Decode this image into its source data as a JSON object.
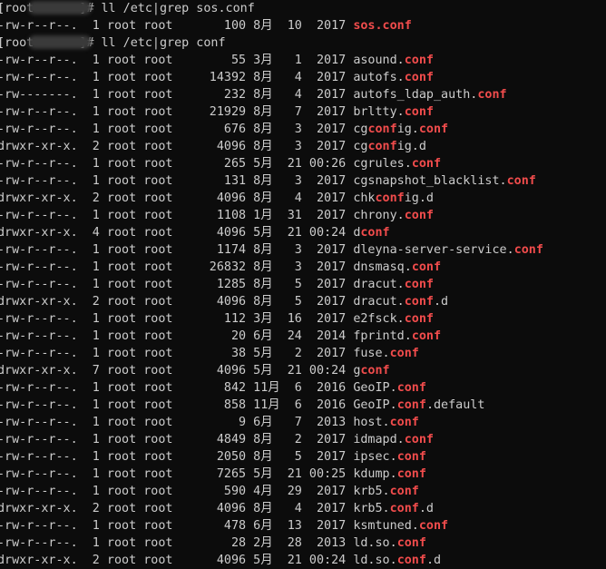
{
  "terminal": {
    "prompt_user": "[root",
    "prompt_suffix": "]#",
    "commands": [
      {
        "command": "ll /etc|grep sos.conf",
        "pattern": "conf",
        "rows": [
          {
            "perm": "-rw-r--r--.",
            "links": "1",
            "owner": "root",
            "group": "root",
            "size": "100",
            "month": "8月",
            "day": "10",
            "time": "2017",
            "name": "sos.conf",
            "whole_highlight": true
          }
        ]
      },
      {
        "command": "ll /etc|grep conf",
        "pattern": "conf",
        "rows": [
          {
            "perm": "-rw-r--r--.",
            "links": "1",
            "owner": "root",
            "group": "root",
            "size": "55",
            "month": "3月",
            "day": "1",
            "time": "2017",
            "name": "asound.conf"
          },
          {
            "perm": "-rw-r--r--.",
            "links": "1",
            "owner": "root",
            "group": "root",
            "size": "14392",
            "month": "8月",
            "day": "4",
            "time": "2017",
            "name": "autofs.conf"
          },
          {
            "perm": "-rw-------.",
            "links": "1",
            "owner": "root",
            "group": "root",
            "size": "232",
            "month": "8月",
            "day": "4",
            "time": "2017",
            "name": "autofs_ldap_auth.conf"
          },
          {
            "perm": "-rw-r--r--.",
            "links": "1",
            "owner": "root",
            "group": "root",
            "size": "21929",
            "month": "8月",
            "day": "7",
            "time": "2017",
            "name": "brltty.conf"
          },
          {
            "perm": "-rw-r--r--.",
            "links": "1",
            "owner": "root",
            "group": "root",
            "size": "676",
            "month": "8月",
            "day": "3",
            "time": "2017",
            "name": "cgconfig.conf"
          },
          {
            "perm": "drwxr-xr-x.",
            "links": "2",
            "owner": "root",
            "group": "root",
            "size": "4096",
            "month": "8月",
            "day": "3",
            "time": "2017",
            "name": "cgconfig.d"
          },
          {
            "perm": "-rw-r--r--.",
            "links": "1",
            "owner": "root",
            "group": "root",
            "size": "265",
            "month": "5月",
            "day": "21",
            "time": "00:26",
            "name": "cgrules.conf"
          },
          {
            "perm": "-rw-r--r--.",
            "links": "1",
            "owner": "root",
            "group": "root",
            "size": "131",
            "month": "8月",
            "day": "3",
            "time": "2017",
            "name": "cgsnapshot_blacklist.conf"
          },
          {
            "perm": "drwxr-xr-x.",
            "links": "2",
            "owner": "root",
            "group": "root",
            "size": "4096",
            "month": "8月",
            "day": "4",
            "time": "2017",
            "name": "chkconfig.d"
          },
          {
            "perm": "-rw-r--r--.",
            "links": "1",
            "owner": "root",
            "group": "root",
            "size": "1108",
            "month": "1月",
            "day": "31",
            "time": "2017",
            "name": "chrony.conf"
          },
          {
            "perm": "drwxr-xr-x.",
            "links": "4",
            "owner": "root",
            "group": "root",
            "size": "4096",
            "month": "5月",
            "day": "21",
            "time": "00:24",
            "name": "dconf"
          },
          {
            "perm": "-rw-r--r--.",
            "links": "1",
            "owner": "root",
            "group": "root",
            "size": "1174",
            "month": "8月",
            "day": "3",
            "time": "2017",
            "name": "dleyna-server-service.conf"
          },
          {
            "perm": "-rw-r--r--.",
            "links": "1",
            "owner": "root",
            "group": "root",
            "size": "26832",
            "month": "8月",
            "day": "3",
            "time": "2017",
            "name": "dnsmasq.conf"
          },
          {
            "perm": "-rw-r--r--.",
            "links": "1",
            "owner": "root",
            "group": "root",
            "size": "1285",
            "month": "8月",
            "day": "5",
            "time": "2017",
            "name": "dracut.conf"
          },
          {
            "perm": "drwxr-xr-x.",
            "links": "2",
            "owner": "root",
            "group": "root",
            "size": "4096",
            "month": "8月",
            "day": "5",
            "time": "2017",
            "name": "dracut.conf.d"
          },
          {
            "perm": "-rw-r--r--.",
            "links": "1",
            "owner": "root",
            "group": "root",
            "size": "112",
            "month": "3月",
            "day": "16",
            "time": "2017",
            "name": "e2fsck.conf"
          },
          {
            "perm": "-rw-r--r--.",
            "links": "1",
            "owner": "root",
            "group": "root",
            "size": "20",
            "month": "6月",
            "day": "24",
            "time": "2014",
            "name": "fprintd.conf"
          },
          {
            "perm": "-rw-r--r--.",
            "links": "1",
            "owner": "root",
            "group": "root",
            "size": "38",
            "month": "5月",
            "day": "2",
            "time": "2017",
            "name": "fuse.conf"
          },
          {
            "perm": "drwxr-xr-x.",
            "links": "7",
            "owner": "root",
            "group": "root",
            "size": "4096",
            "month": "5月",
            "day": "21",
            "time": "00:24",
            "name": "gconf"
          },
          {
            "perm": "-rw-r--r--.",
            "links": "1",
            "owner": "root",
            "group": "root",
            "size": "842",
            "month": "11月",
            "day": "6",
            "time": "2016",
            "name": "GeoIP.conf"
          },
          {
            "perm": "-rw-r--r--.",
            "links": "1",
            "owner": "root",
            "group": "root",
            "size": "858",
            "month": "11月",
            "day": "6",
            "time": "2016",
            "name": "GeoIP.conf.default"
          },
          {
            "perm": "-rw-r--r--.",
            "links": "1",
            "owner": "root",
            "group": "root",
            "size": "9",
            "month": "6月",
            "day": "7",
            "time": "2013",
            "name": "host.conf"
          },
          {
            "perm": "-rw-r--r--.",
            "links": "1",
            "owner": "root",
            "group": "root",
            "size": "4849",
            "month": "8月",
            "day": "2",
            "time": "2017",
            "name": "idmapd.conf"
          },
          {
            "perm": "-rw-r--r--.",
            "links": "1",
            "owner": "root",
            "group": "root",
            "size": "2050",
            "month": "8月",
            "day": "5",
            "time": "2017",
            "name": "ipsec.conf"
          },
          {
            "perm": "-rw-r--r--.",
            "links": "1",
            "owner": "root",
            "group": "root",
            "size": "7265",
            "month": "5月",
            "day": "21",
            "time": "00:25",
            "name": "kdump.conf"
          },
          {
            "perm": "-rw-r--r--.",
            "links": "1",
            "owner": "root",
            "group": "root",
            "size": "590",
            "month": "4月",
            "day": "29",
            "time": "2017",
            "name": "krb5.conf"
          },
          {
            "perm": "drwxr-xr-x.",
            "links": "2",
            "owner": "root",
            "group": "root",
            "size": "4096",
            "month": "8月",
            "day": "4",
            "time": "2017",
            "name": "krb5.conf.d"
          },
          {
            "perm": "-rw-r--r--.",
            "links": "1",
            "owner": "root",
            "group": "root",
            "size": "478",
            "month": "6月",
            "day": "13",
            "time": "2017",
            "name": "ksmtuned.conf"
          },
          {
            "perm": "-rw-r--r--.",
            "links": "1",
            "owner": "root",
            "group": "root",
            "size": "28",
            "month": "2月",
            "day": "28",
            "time": "2013",
            "name": "ld.so.conf"
          },
          {
            "perm": "drwxr-xr-x.",
            "links": "2",
            "owner": "root",
            "group": "root",
            "size": "4096",
            "month": "5月",
            "day": "21",
            "time": "00:24",
            "name": "ld.so.conf.d"
          }
        ]
      }
    ]
  },
  "colors": {
    "background": "#0c0c0c",
    "text": "#cccccc",
    "highlight": "#f14c4c"
  }
}
